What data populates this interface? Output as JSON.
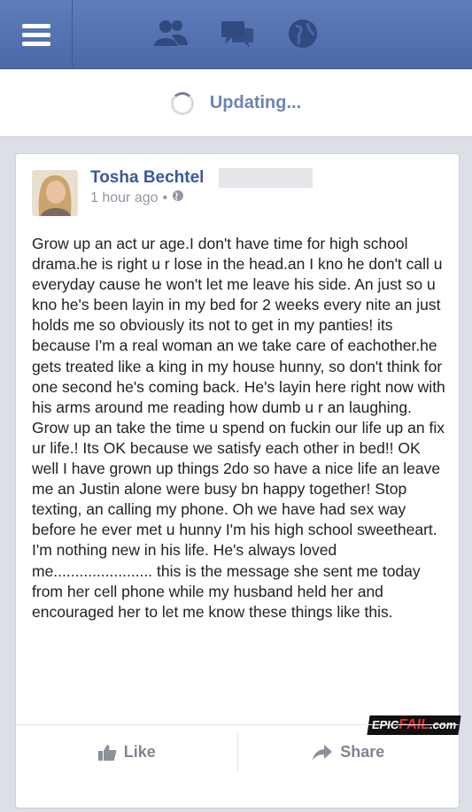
{
  "status": {
    "updating_text": "Updating..."
  },
  "post": {
    "author": "Tosha Bechtel",
    "time": "1 hour ago",
    "body": "Grow up an act ur age.I don't have time for high school drama.he is right u r lose in the head.an I kno he don't call u everyday cause he won't let me leave his side. An just so u kno he's been layin in my bed for 2 weeks every nite an just holds me so obviously its not to get in my panties! its because I'm a real woman an we take care of eachother.he gets treated like a king in my house hunny, so don't think for one second he's coming back. He's layin here right now with his arms around me reading how dumb u r an laughing. Grow up an take the time u spend on fuckin our life up an fix ur life.! Its OK because we satisfy each other in bed!! OK well I have grown up things 2do so have a nice life an leave me an Justin alone were busy bn happy together! Stop texting, an calling my phone. Oh we have had sex way before he ever met u hunny I'm his high school sweetheart. I'm nothing new in his life. He's always loved me....................... this is the message she sent me today from her cell phone while my husband held her and encouraged her to let me know these things like this."
  },
  "actions": {
    "like_label": "Like",
    "share_label": "Share"
  },
  "watermark": {
    "part1": "EPIC",
    "part2": "FAIL",
    "part3": ".com"
  },
  "icons": {
    "menu": "menu-icon",
    "friends": "friends-icon",
    "messages": "messages-icon",
    "notifications": "globe-icon",
    "spinner": "spinner-icon",
    "privacy": "globe-icon",
    "like": "thumbs-up-icon",
    "share": "share-arrow-icon"
  },
  "colors": {
    "brand": "#4b68a8",
    "link": "#3b5998",
    "muted": "#9197a3"
  }
}
